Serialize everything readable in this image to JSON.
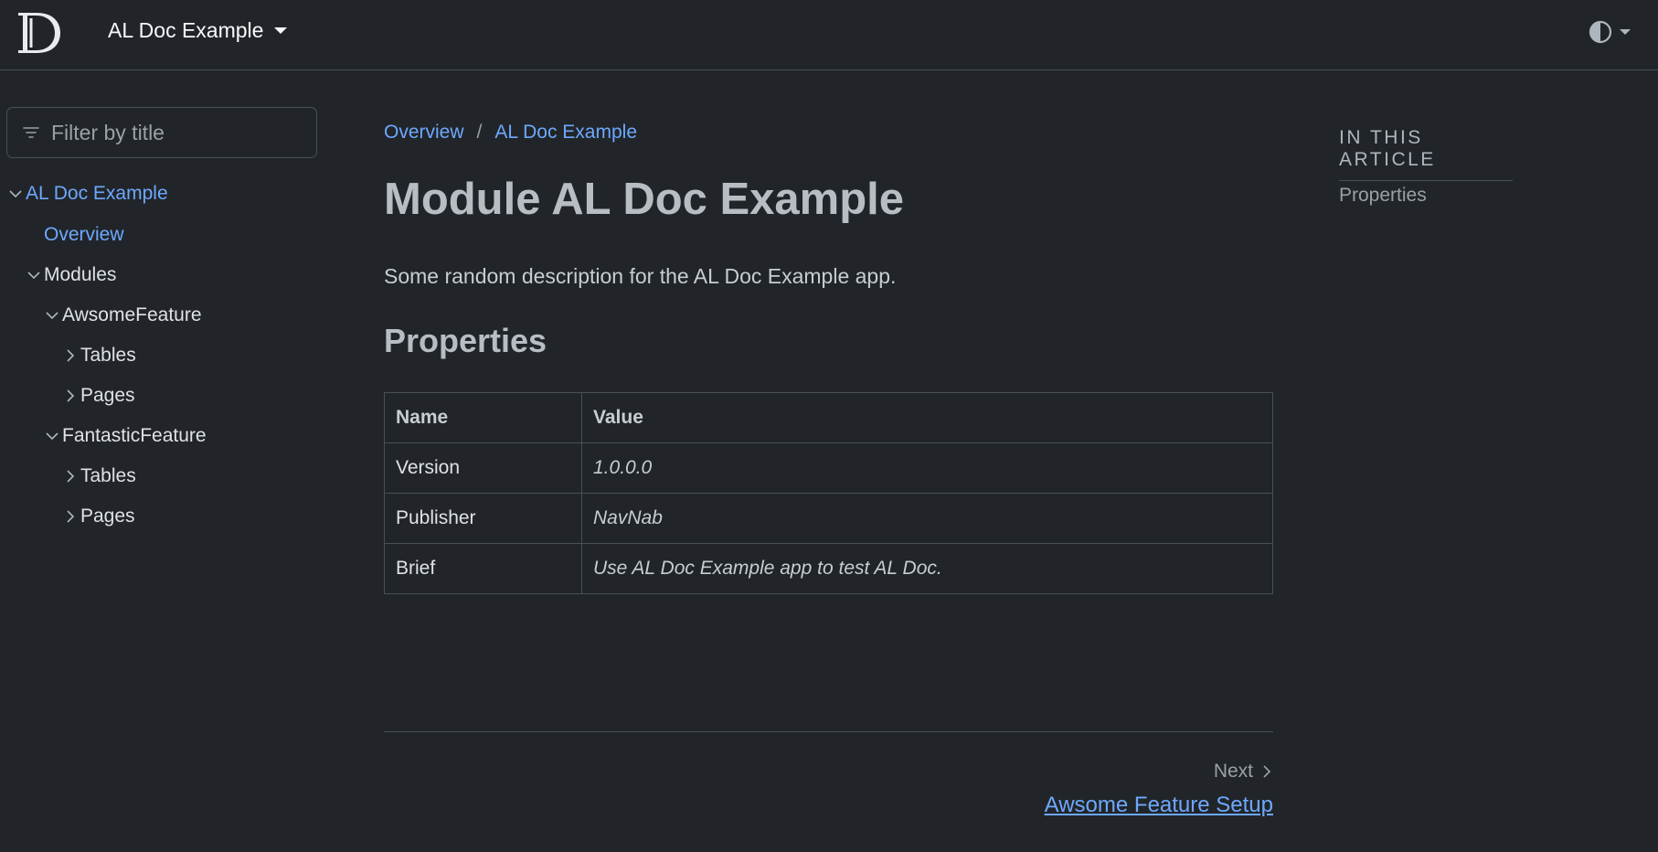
{
  "header": {
    "brand_title": "AL Doc Example",
    "logo_icon": "docfx-logo-icon",
    "theme_icon": "theme-contrast-icon"
  },
  "sidebar": {
    "filter_placeholder": "Filter by title",
    "items": [
      {
        "label": "AL Doc Example",
        "state": "expanded",
        "link": true
      },
      {
        "label": "Overview",
        "state": "leaf",
        "link": true
      },
      {
        "label": "Modules",
        "state": "expanded",
        "link": false
      },
      {
        "label": "AwsomeFeature",
        "state": "expanded",
        "link": false
      },
      {
        "label": "Tables",
        "state": "collapsed",
        "link": false
      },
      {
        "label": "Pages",
        "state": "collapsed",
        "link": false
      },
      {
        "label": "FantasticFeature",
        "state": "expanded",
        "link": false
      },
      {
        "label": "Tables",
        "state": "collapsed",
        "link": false
      },
      {
        "label": "Pages",
        "state": "collapsed",
        "link": false
      }
    ]
  },
  "main": {
    "breadcrumb": [
      "Overview",
      "AL Doc Example"
    ],
    "breadcrumb_separator": "/",
    "title": "Module AL Doc Example",
    "description": "Some random description for the AL Doc Example app.",
    "section_heading": "Properties",
    "table": {
      "headers": [
        "Name",
        "Value"
      ],
      "rows": [
        [
          "Version",
          "1.0.0.0"
        ],
        [
          "Publisher",
          "NavNab"
        ],
        [
          "Brief",
          "Use AL Doc Example app to test AL Doc."
        ]
      ]
    },
    "next_label": "Next",
    "next_link": "Awsome Feature Setup"
  },
  "right_panel": {
    "heading": "IN THIS ARTICLE",
    "links": [
      "Properties"
    ]
  },
  "colors": {
    "background": "#212529",
    "link": "#6ea8fe",
    "border": "#495057"
  }
}
